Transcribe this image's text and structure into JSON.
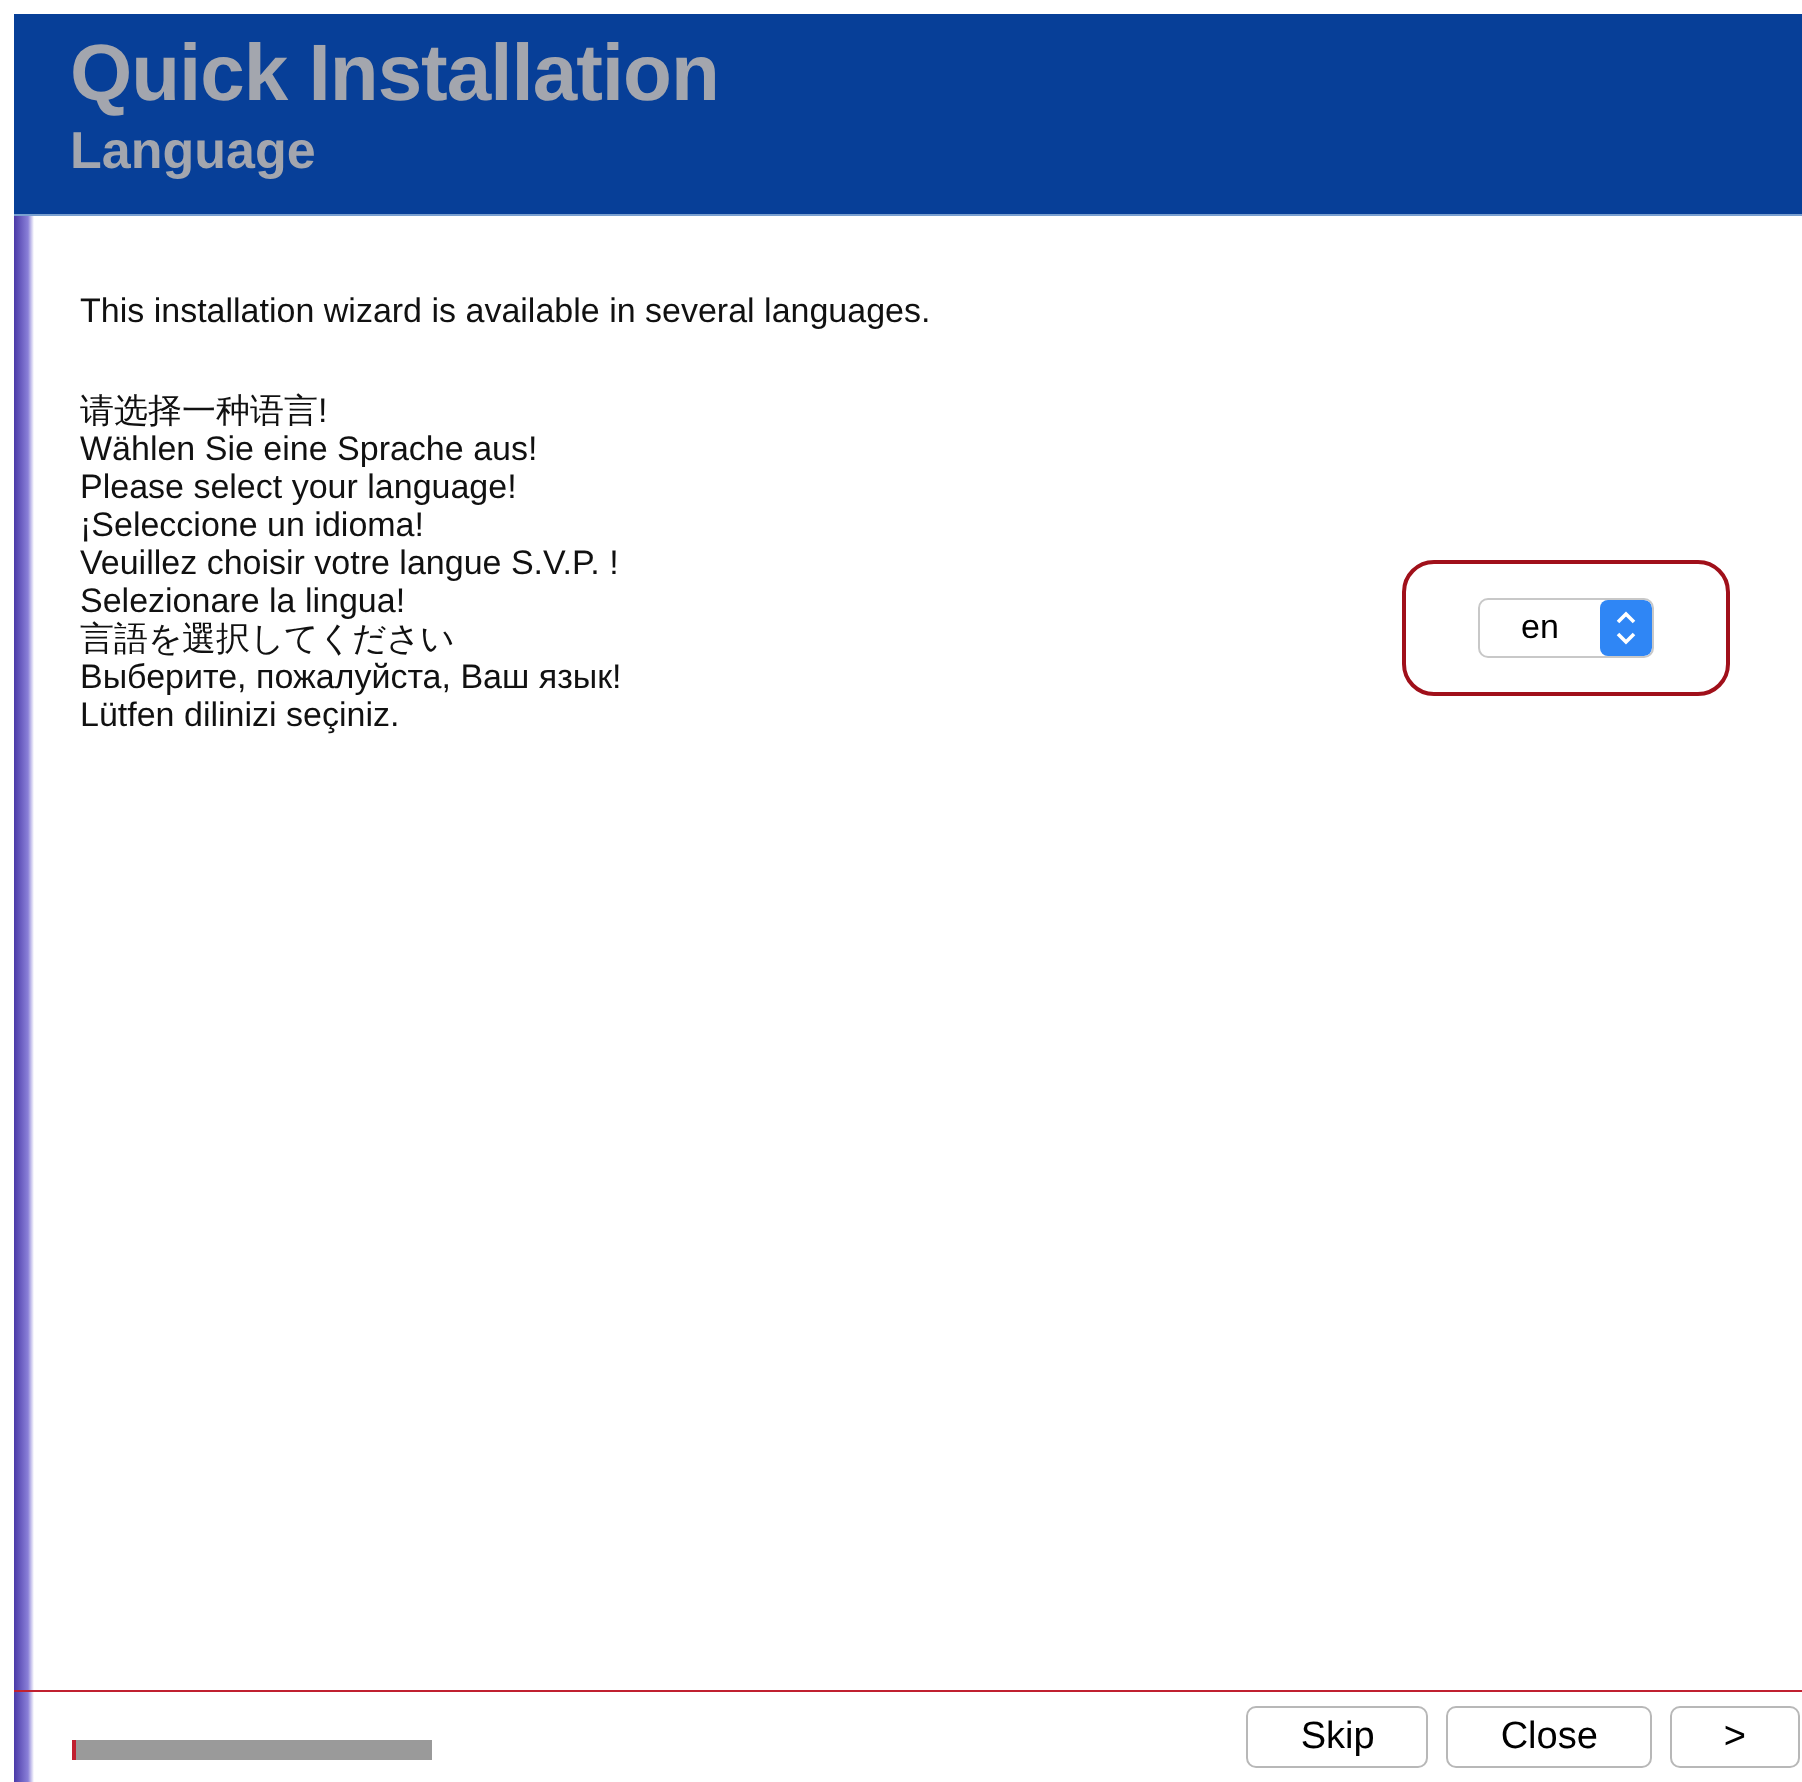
{
  "header": {
    "title": "Quick Installation",
    "subtitle": "Language"
  },
  "intro": "This installation wizard is available in several languages.",
  "prompts": [
    "请选择一种语言!",
    "Wählen Sie eine Sprache aus!",
    "Please select your language!",
    "¡Seleccione un idioma!",
    "Veuillez choisir votre langue S.V.P. !",
    "Selezionare la lingua!",
    "言語を選択してください",
    "Выберите, пожалуйста, Ваш язык!",
    "Lütfen dilinizi seçiniz."
  ],
  "language_select": {
    "value": "en",
    "highlighted": true
  },
  "progress": {
    "level": 0.01
  },
  "buttons": [
    {
      "label": "Skip"
    },
    {
      "label": "Close"
    },
    {
      "label": ">"
    }
  ]
}
